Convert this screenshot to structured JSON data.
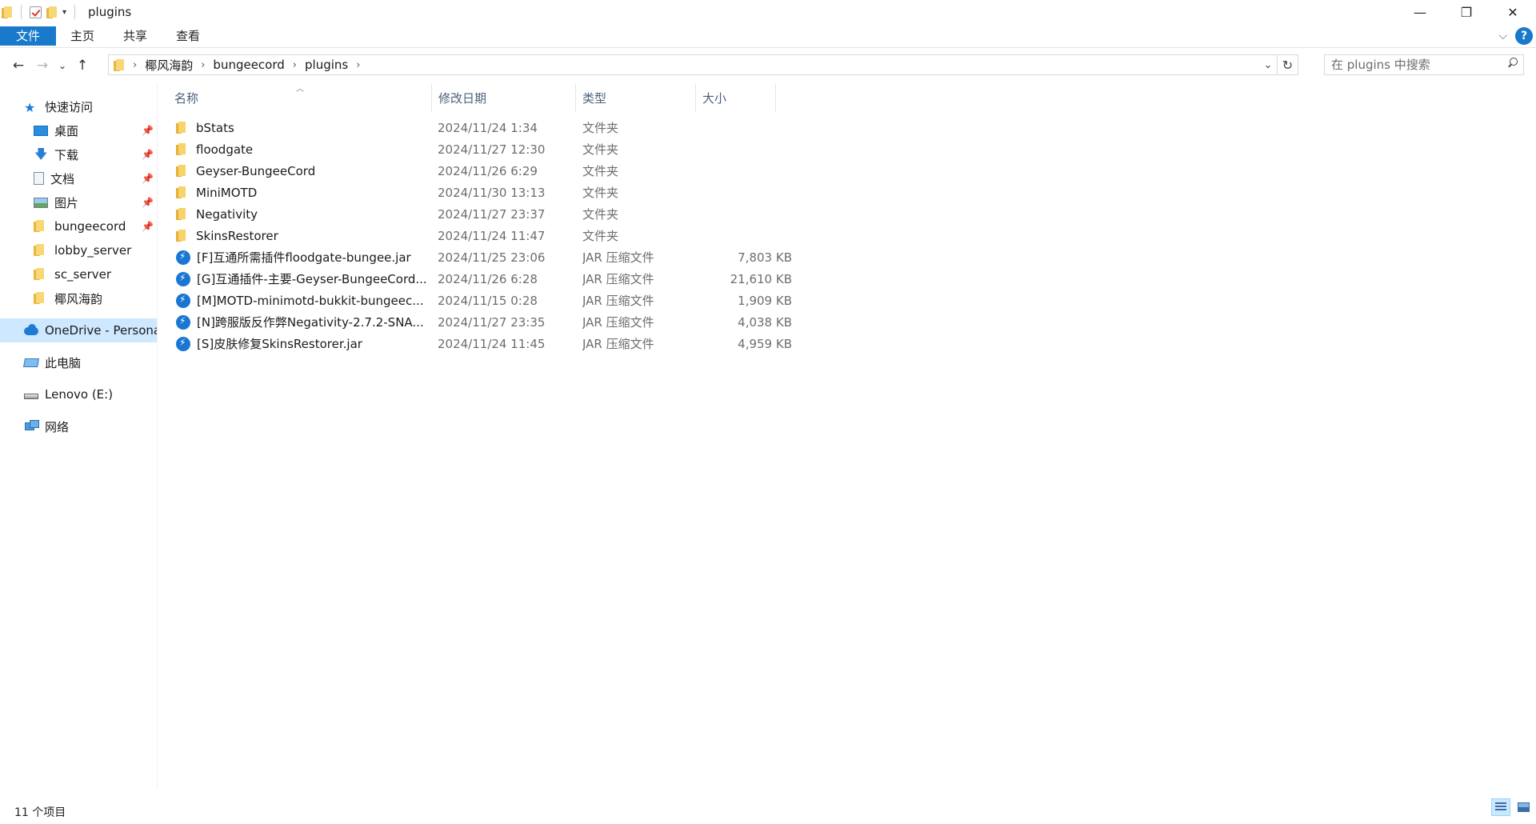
{
  "window": {
    "title": "plugins"
  },
  "ribbon": {
    "tabs": [
      "文件",
      "主页",
      "共享",
      "查看"
    ]
  },
  "address": {
    "breadcrumbs": [
      "椰风海韵",
      "bungeecord",
      "plugins"
    ]
  },
  "search": {
    "placeholder": "在 plugins 中搜索"
  },
  "sidebar": {
    "quick_access": "快速访问",
    "items": [
      {
        "label": "桌面",
        "icon": "desktop-icon",
        "pinned": true
      },
      {
        "label": "下载",
        "icon": "download-icon",
        "pinned": true
      },
      {
        "label": "文档",
        "icon": "document-icon",
        "pinned": true
      },
      {
        "label": "图片",
        "icon": "pictures-icon",
        "pinned": true
      },
      {
        "label": "bungeecord",
        "icon": "folder-icon",
        "pinned": true
      },
      {
        "label": "lobby_server",
        "icon": "folder-icon",
        "pinned": false
      },
      {
        "label": "sc_server",
        "icon": "folder-icon",
        "pinned": false
      },
      {
        "label": "椰风海韵",
        "icon": "folder-icon",
        "pinned": false
      }
    ],
    "onedrive": "OneDrive - Persona",
    "this_pc": "此电脑",
    "drive": "Lenovo (E:)",
    "network": "网络"
  },
  "columns": {
    "name": "名称",
    "date": "修改日期",
    "type": "类型",
    "size": "大小"
  },
  "files": [
    {
      "name": "bStats",
      "date": "2024/11/24 1:34",
      "type": "文件夹",
      "size": "",
      "icon": "folder"
    },
    {
      "name": "floodgate",
      "date": "2024/11/27 12:30",
      "type": "文件夹",
      "size": "",
      "icon": "folder"
    },
    {
      "name": "Geyser-BungeeCord",
      "date": "2024/11/26 6:29",
      "type": "文件夹",
      "size": "",
      "icon": "folder"
    },
    {
      "name": "MiniMOTD",
      "date": "2024/11/30 13:13",
      "type": "文件夹",
      "size": "",
      "icon": "folder"
    },
    {
      "name": "Negativity",
      "date": "2024/11/27 23:37",
      "type": "文件夹",
      "size": "",
      "icon": "folder"
    },
    {
      "name": "SkinsRestorer",
      "date": "2024/11/24 11:47",
      "type": "文件夹",
      "size": "",
      "icon": "folder"
    },
    {
      "name": "[F]互通所需插件floodgate-bungee.jar",
      "date": "2024/11/25 23:06",
      "type": "JAR 压缩文件",
      "size": "7,803 KB",
      "icon": "jar"
    },
    {
      "name": "[G]互通插件-主要-Geyser-BungeeCord...",
      "date": "2024/11/26 6:28",
      "type": "JAR 压缩文件",
      "size": "21,610 KB",
      "icon": "jar"
    },
    {
      "name": "[M]MOTD-minimotd-bukkit-bungeec...",
      "date": "2024/11/15 0:28",
      "type": "JAR 压缩文件",
      "size": "1,909 KB",
      "icon": "jar"
    },
    {
      "name": "[N]跨服版反作弊Negativity-2.7.2-SNA...",
      "date": "2024/11/27 23:35",
      "type": "JAR 压缩文件",
      "size": "4,038 KB",
      "icon": "jar"
    },
    {
      "name": "[S]皮肤修复SkinsRestorer.jar",
      "date": "2024/11/24 11:45",
      "type": "JAR 压缩文件",
      "size": "4,959 KB",
      "icon": "jar"
    }
  ],
  "status": {
    "count": "11 个项目"
  }
}
